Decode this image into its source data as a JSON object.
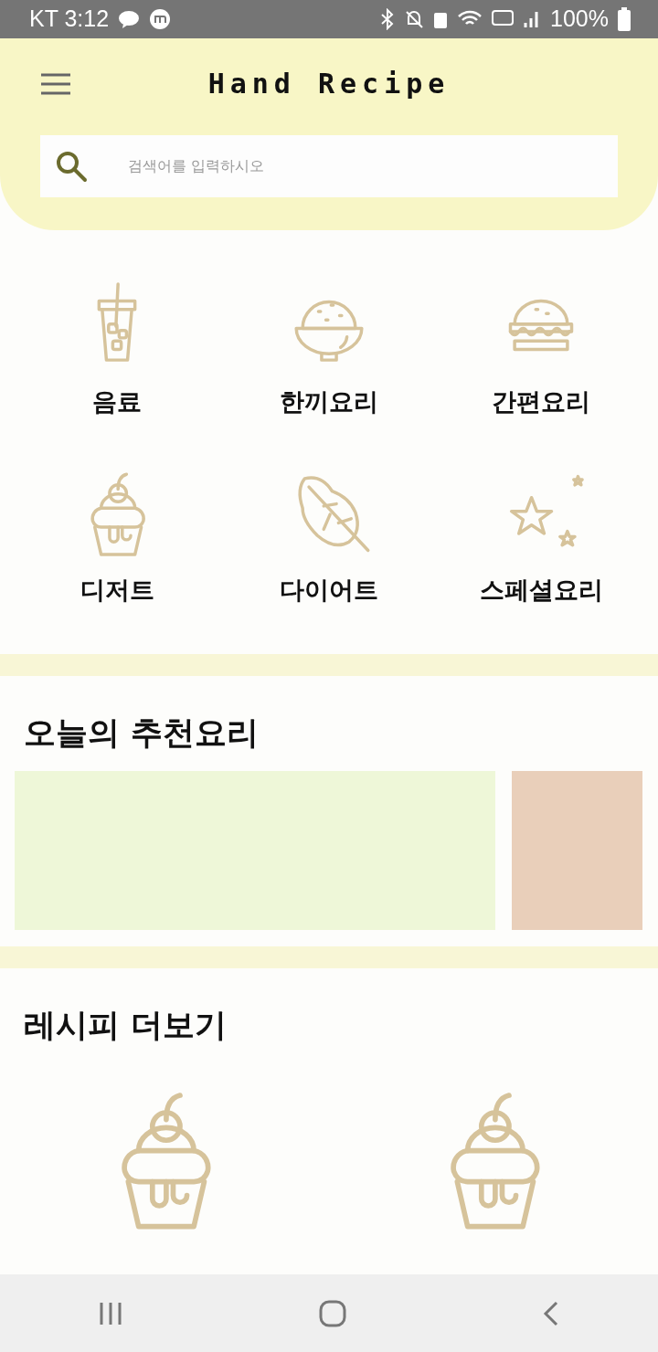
{
  "status_bar": {
    "carrier_time": "KT 3:12",
    "battery": "100%"
  },
  "header": {
    "title": "Hand Recipe"
  },
  "search": {
    "placeholder": "검색어를 입력하시오"
  },
  "categories": [
    {
      "label": "음료",
      "kind": "drink"
    },
    {
      "label": "한끼요리",
      "kind": "rice"
    },
    {
      "label": "간편요리",
      "kind": "burger"
    },
    {
      "label": "디저트",
      "kind": "dessert"
    },
    {
      "label": "다이어트",
      "kind": "leaf"
    },
    {
      "label": "스페셜요리",
      "kind": "star"
    }
  ],
  "today": {
    "title": "오늘의 추천요리",
    "cards": [
      {
        "color": "#eef7d8"
      },
      {
        "color": "#e9cfba"
      }
    ]
  },
  "more": {
    "title": "레시피 더보기",
    "items": [
      {
        "kind": "dessert"
      },
      {
        "kind": "dessert"
      }
    ]
  }
}
